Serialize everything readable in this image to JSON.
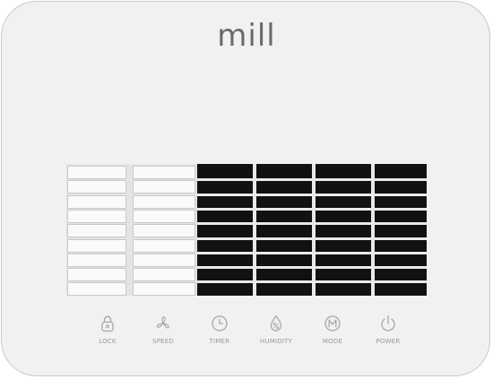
{
  "brand": {
    "logo_text": "mill"
  },
  "controls": [
    {
      "label": "LOCK",
      "icon": "lock-icon"
    },
    {
      "label": "SPEED",
      "icon": "fan-icon"
    },
    {
      "label": "TIMER",
      "icon": "clock-icon"
    },
    {
      "label": "HUMIDITY",
      "icon": "droplet-percent-icon"
    },
    {
      "label": "MODE",
      "icon": "mode-m-icon"
    },
    {
      "label": "POWER",
      "icon": "power-icon"
    }
  ],
  "colors": {
    "body": "#f1f1f1",
    "grille_dark": "#111111",
    "grille_light": "#e4e4e4",
    "icon_stroke": "#a6a6a6",
    "logo": "#6a6a6a"
  }
}
